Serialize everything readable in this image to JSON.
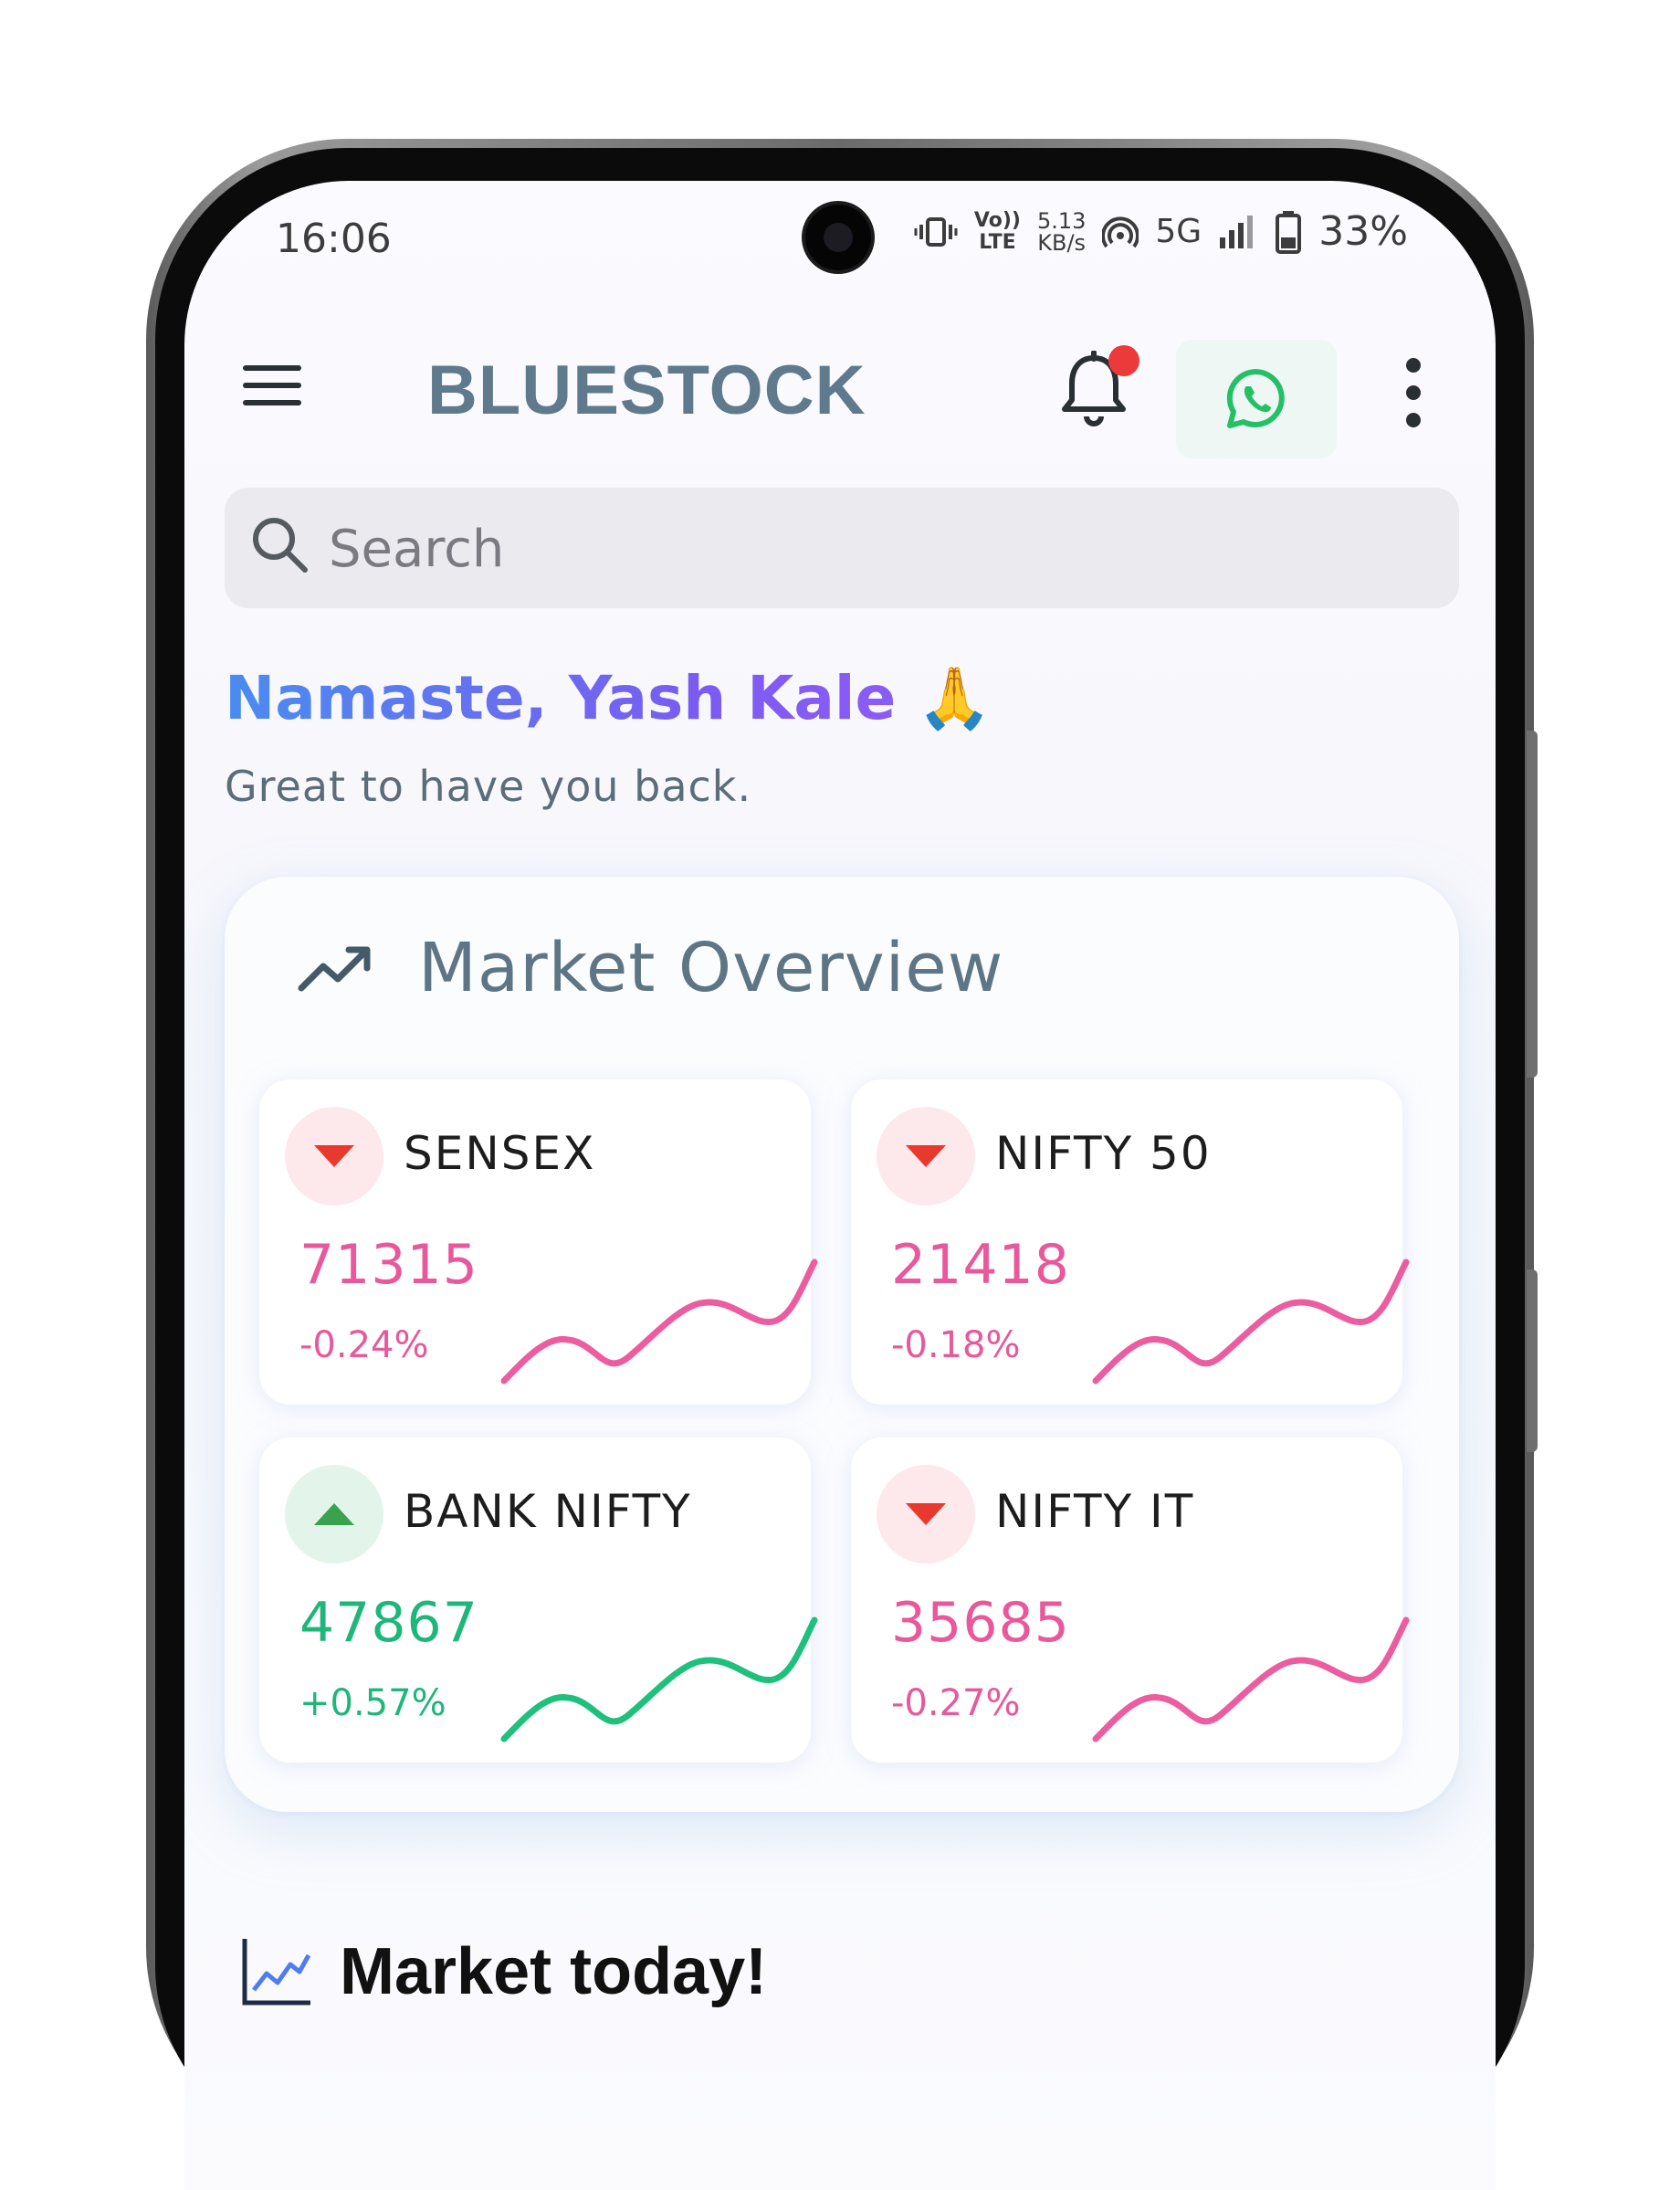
{
  "status_bar": {
    "time": "16:06",
    "volte_top": "Vo))",
    "volte_bottom": "LTE",
    "speed_top": "5.13",
    "speed_bottom": "KB/s",
    "network": "5G",
    "battery": "33%"
  },
  "app_bar": {
    "brand": "BLUESTOCK",
    "notification_dot": true,
    "icons": [
      "menu-icon",
      "bell-icon",
      "whatsapp-icon",
      "more-vertical-icon"
    ]
  },
  "search": {
    "placeholder": "Search",
    "value": ""
  },
  "greeting": {
    "title": "Namaste, Yash Kale",
    "emoji": "🙏",
    "subtitle": "Great to have you back."
  },
  "market_overview": {
    "title": "Market Overview",
    "indices": [
      {
        "name": "SENSEX",
        "value": "71315",
        "change": "-0.24%",
        "direction": "down"
      },
      {
        "name": "NIFTY 50",
        "value": "21418",
        "change": "-0.18%",
        "direction": "down"
      },
      {
        "name": "BANK NIFTY",
        "value": "47867",
        "change": "+0.57%",
        "direction": "up"
      },
      {
        "name": "NIFTY IT",
        "value": "35685",
        "change": "-0.27%",
        "direction": "down"
      }
    ]
  },
  "market_today": {
    "title": "Market today!"
  },
  "colors": {
    "brand": "#5f7a8c",
    "negative": "#e8589a",
    "positive": "#1fb67a",
    "arrow_down": "#e8392f",
    "arrow_up": "#3aa24f"
  }
}
